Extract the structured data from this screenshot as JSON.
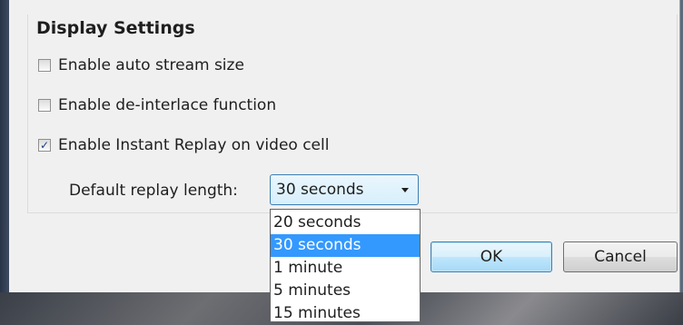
{
  "dialog": {
    "section_title": "Display Settings",
    "options": [
      {
        "label": "Enable auto stream size",
        "checked": false
      },
      {
        "label": "Enable de-interlace function",
        "checked": false
      },
      {
        "label": "Enable Instant Replay on video cell",
        "checked": true
      }
    ],
    "replay": {
      "label": "Default replay length:",
      "selected": "30 seconds",
      "choices": [
        "20 seconds",
        "30 seconds",
        "1 minute",
        "5 minutes",
        "15 minutes"
      ]
    },
    "buttons": {
      "ok": "OK",
      "cancel": "Cancel"
    }
  },
  "colors": {
    "selection": "#3399ff",
    "check_mark": "#1b3d82"
  }
}
